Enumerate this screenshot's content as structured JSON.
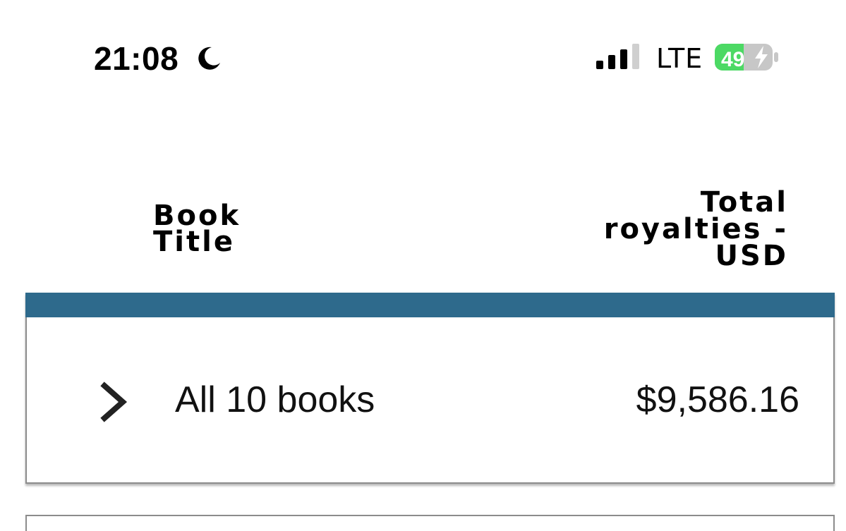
{
  "status_bar": {
    "time": "21:08",
    "focus_icon": "moon-icon",
    "signal_icon": "cellular-signal-icon",
    "carrier": "LTE",
    "battery_level": "49",
    "battery_charging_icon": "bolt-icon",
    "battery_color": "#4cd964"
  },
  "table": {
    "headers": {
      "book_title": [
        "Book",
        "Title"
      ],
      "royalties": [
        "Total",
        "royalties -",
        "USD"
      ]
    },
    "accent_color": "#2e6a8c",
    "rows": [
      {
        "expand_icon": "chevron-right-icon",
        "label": "All 10 books",
        "value": "$9,586.16"
      }
    ]
  }
}
